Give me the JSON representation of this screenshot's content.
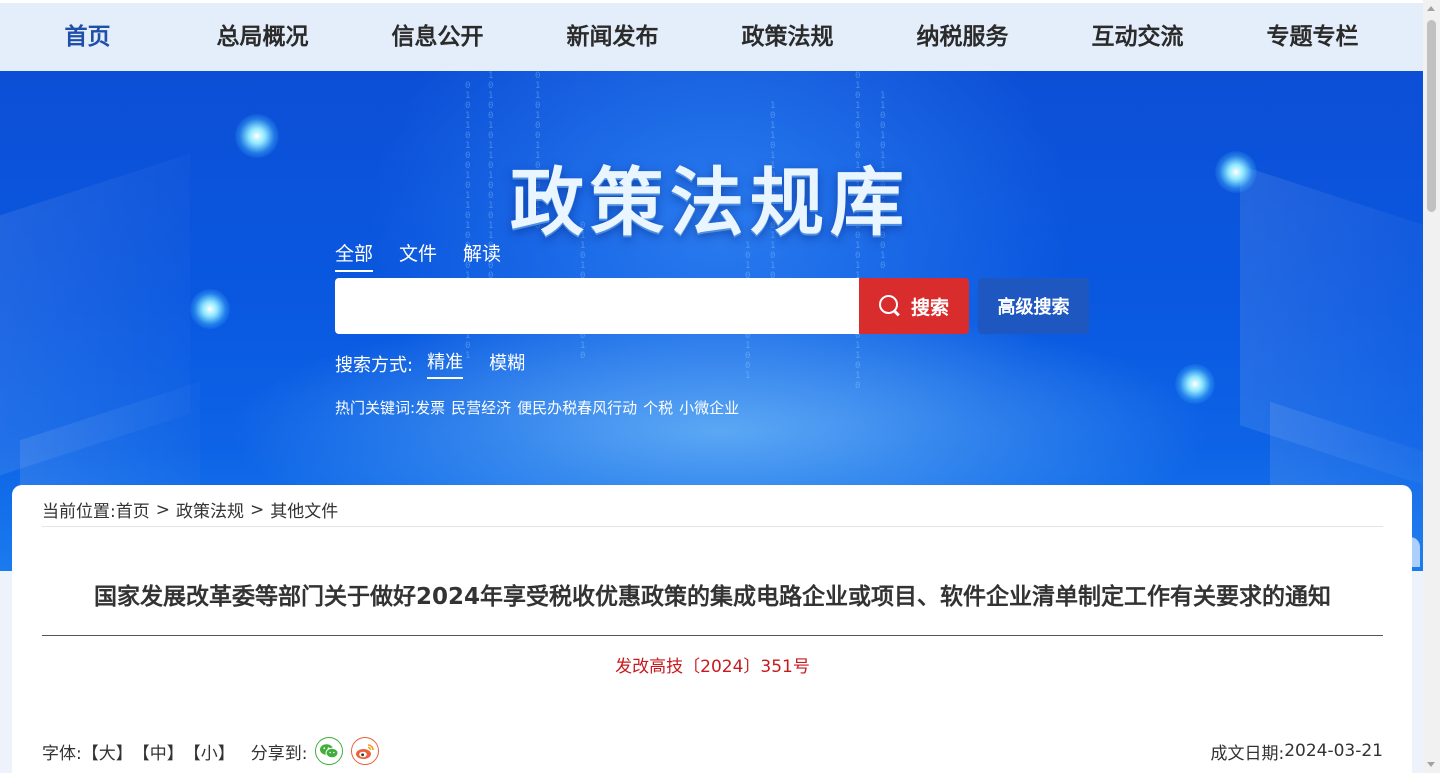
{
  "nav": {
    "items": [
      {
        "label": "首页",
        "active": true
      },
      {
        "label": "总局概况"
      },
      {
        "label": "信息公开"
      },
      {
        "label": "新闻发布"
      },
      {
        "label": "政策法规"
      },
      {
        "label": "纳税服务"
      },
      {
        "label": "互动交流"
      },
      {
        "label": "专题专栏"
      }
    ]
  },
  "banner": {
    "title": "政策法规库",
    "search_tabs": [
      "全部",
      "文件",
      "解读"
    ],
    "search": {
      "value": "",
      "button_label": "搜索",
      "advanced_label": "高级搜索"
    },
    "mode": {
      "label": "搜索方式:",
      "options": [
        "精准",
        "模糊"
      ]
    },
    "hot": {
      "label": "热门关键词:",
      "keywords": [
        "发票",
        "民营经济",
        "便民办税春风行动",
        "个税",
        "小微企业"
      ]
    }
  },
  "breadcrumb": {
    "label": "当前位置:",
    "items": [
      "首页",
      "政策法规",
      "其他文件"
    ],
    "separator": ">"
  },
  "document": {
    "title": "国家发展改革委等部门关于做好2024年享受税收优惠政策的集成电路企业或项目、软件企业清单制定工作有关要求的通知",
    "doc_number": "发改高技〔2024〕351号",
    "font_label": "字体:",
    "font_sizes": [
      "【大】",
      "【中】",
      "【小】"
    ],
    "share_label": "分享到:",
    "date_label": "成文日期:",
    "date": "2024-03-21"
  },
  "colors": {
    "accent_red": "#d92d2d",
    "nav_active": "#1f4fa8",
    "doc_number": "#c8191e"
  }
}
